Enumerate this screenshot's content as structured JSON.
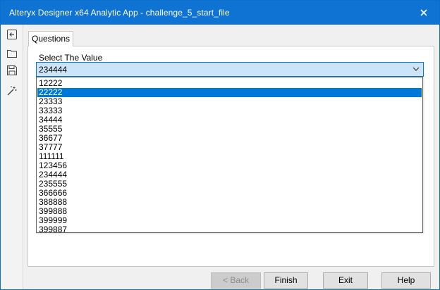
{
  "window": {
    "title": "Alteryx Designer x64 Analytic App - challenge_5_start_file",
    "accent": "#0f73d3"
  },
  "sidebar": {
    "icons": [
      "back-arrow-icon",
      "folder-icon",
      "save-icon",
      "magic-wand-icon"
    ]
  },
  "tabs": [
    {
      "label": "Questions",
      "active": true
    }
  ],
  "question": {
    "label": "Select The Value",
    "selected_value": "234444",
    "highlighted_option": "22222",
    "options": [
      "12222",
      "22222",
      "23333",
      "33333",
      "34444",
      "35555",
      "36677",
      "37777",
      "111111",
      "123456",
      "234444",
      "235555",
      "366666",
      "388888",
      "399888",
      "399999",
      "399887"
    ]
  },
  "buttons": {
    "back": {
      "label": "< Back",
      "enabled": false
    },
    "finish": {
      "label": "Finish",
      "enabled": true
    },
    "exit": {
      "label": "Exit",
      "enabled": true
    },
    "help": {
      "label": "Help",
      "enabled": true
    }
  }
}
